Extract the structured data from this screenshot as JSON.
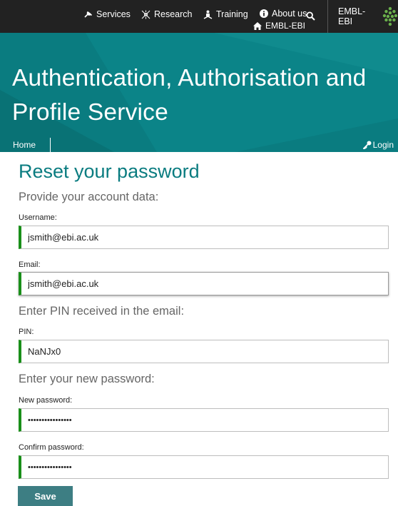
{
  "topbar": {
    "services_label": "Services",
    "research_label": "Research",
    "training_label": "Training",
    "about_label": "About us",
    "home_label": "EMBL-EBI",
    "embl_label": "EMBL-EBI"
  },
  "masthead": {
    "title": "Authentication, Authorisation and Profile Service",
    "home_label": "Home",
    "login_label": "Login"
  },
  "page": {
    "title": "Reset your password",
    "section_account": "Provide your account data:",
    "username_label": "Username:",
    "username_value": "jsmith@ebi.ac.uk",
    "email_label": "Email:",
    "email_value": "jsmith@ebi.ac.uk",
    "section_pin": "Enter PIN received in the email:",
    "pin_label": "PIN:",
    "pin_value": "NaNJx0",
    "section_password": "Enter your new password:",
    "new_password_label": "New password:",
    "new_password_value": "••••••••••••••••",
    "confirm_password_label": "Confirm password:",
    "confirm_password_value": "••••••••••••••••",
    "save_label": "Save"
  },
  "colors": {
    "topbar": "#222222",
    "masthead": "#0a7c80",
    "title_accent": "#0a7c80",
    "input_accent": "#1a8f1a",
    "save_button": "#3d7e83"
  }
}
